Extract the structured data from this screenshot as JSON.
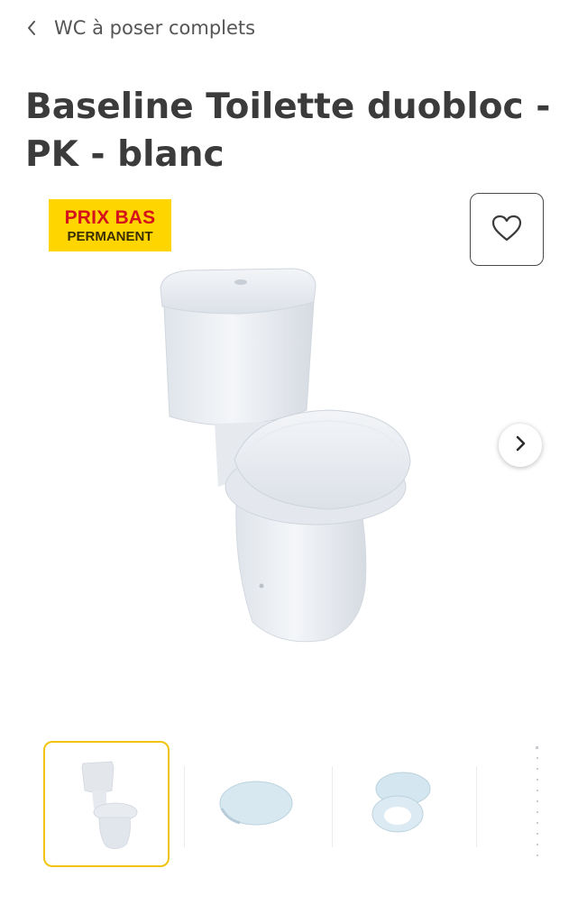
{
  "breadcrumb": {
    "back_icon": "chevron-left-icon",
    "label": "WC à poser complets"
  },
  "product": {
    "title": "Baseline Toilette duobloc - PK - blanc",
    "badge": {
      "line1": "PRIX BAS",
      "line2": "PERMANENT"
    },
    "favorite_icon": "heart-outline-icon",
    "next_icon": "chevron-right-icon"
  },
  "gallery": {
    "thumbnails": [
      {
        "name": "toilet-front",
        "selected": true
      },
      {
        "name": "seat-closed",
        "selected": false
      },
      {
        "name": "seat-open",
        "selected": false
      },
      {
        "name": "partial-thumb",
        "selected": false
      }
    ]
  },
  "colors": {
    "badge_bg": "#ffd500",
    "badge_text_red": "#d5121b",
    "selected_border": "#f1c40f"
  }
}
